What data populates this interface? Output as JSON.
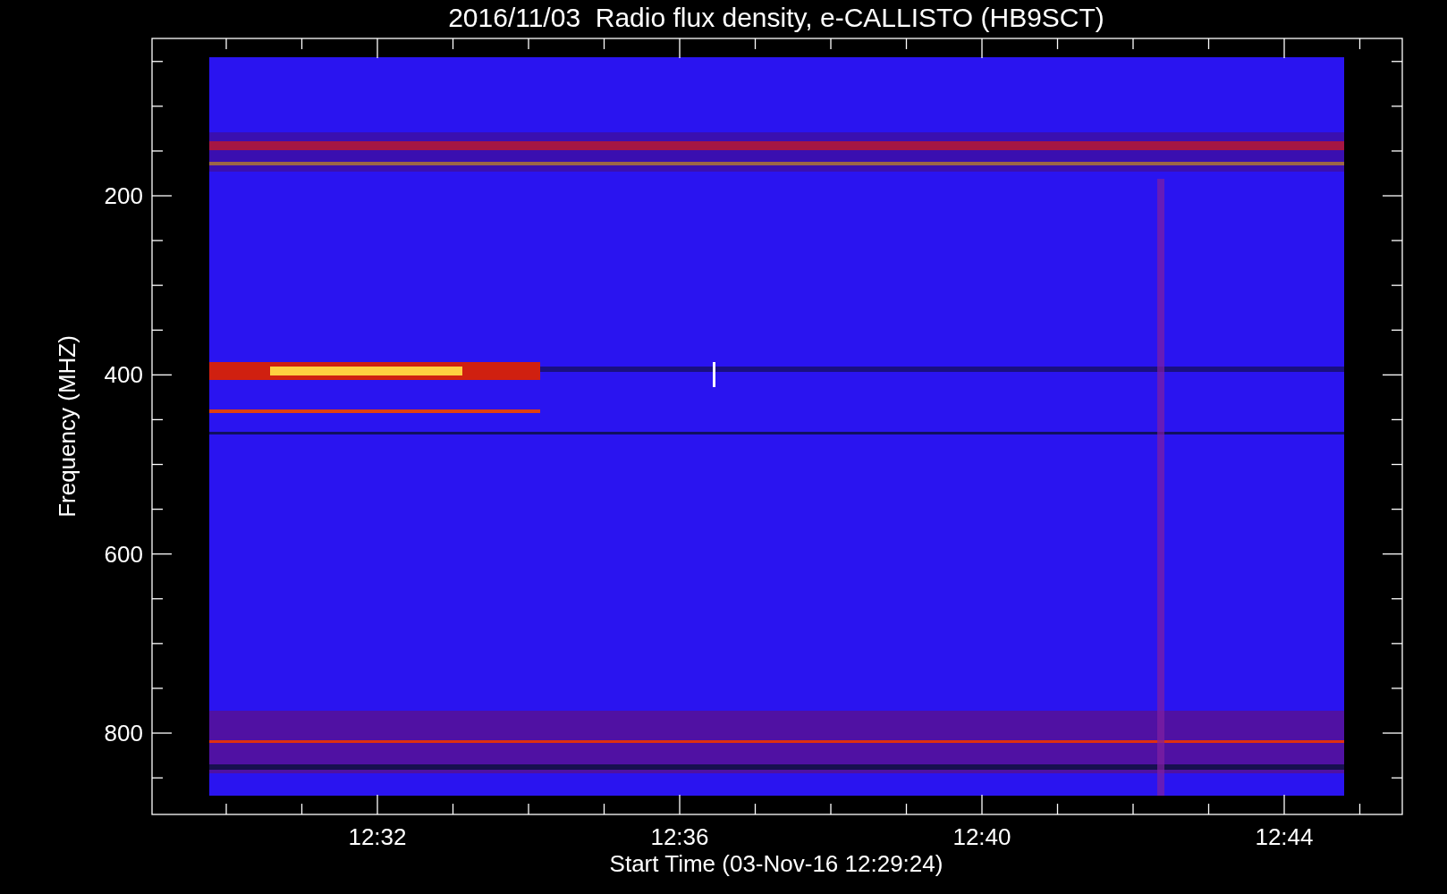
{
  "title": "2016/11/03  Radio flux density, e-CALLISTO (HB9SCT)",
  "y_axis": {
    "label": "Frequency (MHZ)",
    "ticks": [
      "200",
      "400",
      "600",
      "800"
    ]
  },
  "x_axis": {
    "label": "Start Time (03-Nov-16 12:29:24)",
    "ticks": [
      "12:32",
      "12:36",
      "12:40",
      "12:44"
    ]
  }
}
